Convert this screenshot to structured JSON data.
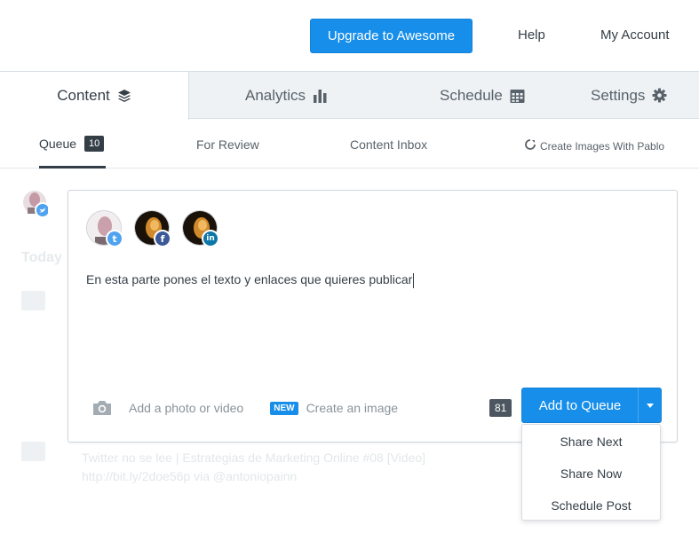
{
  "header": {
    "upgrade_label": "Upgrade to Awesome",
    "help_label": "Help",
    "account_label": "My Account"
  },
  "tabs": [
    {
      "label": "Content",
      "icon": "layers-icon"
    },
    {
      "label": "Analytics",
      "icon": "bar-chart-icon"
    },
    {
      "label": "Schedule",
      "icon": "calendar-icon"
    },
    {
      "label": "Settings",
      "icon": "gear-icon"
    }
  ],
  "subtabs": {
    "queue_label": "Queue",
    "queue_count": "10",
    "review_label": "For Review",
    "inbox_label": "Content Inbox",
    "pablo_label": "Create Images With Pablo"
  },
  "sidebar": {
    "today_label": "Today"
  },
  "composer": {
    "text": "En esta parte pones el texto y enlaces que quieres publicar",
    "profiles": [
      {
        "network": "twitter",
        "badge": "t"
      },
      {
        "network": "facebook",
        "badge": "f"
      },
      {
        "network": "linkedin",
        "badge": "in"
      }
    ],
    "media_label": "Add a photo or video",
    "new_badge": "NEW",
    "create_image_label": "Create an image",
    "char_count": "81",
    "add_queue_label": "Add to Queue"
  },
  "dropdown": {
    "items": [
      "Share Next",
      "Share Now",
      "Schedule Post"
    ]
  },
  "background_post": {
    "line1": "Twitter no se lee | Estrategias de Marketing Online #08 [Video]",
    "line2": "http://bit.ly/2doe56p via @antoniopainn"
  },
  "colors": {
    "accent": "#168eea",
    "text": "#343e47",
    "tab_bg": "#eef2f5"
  }
}
